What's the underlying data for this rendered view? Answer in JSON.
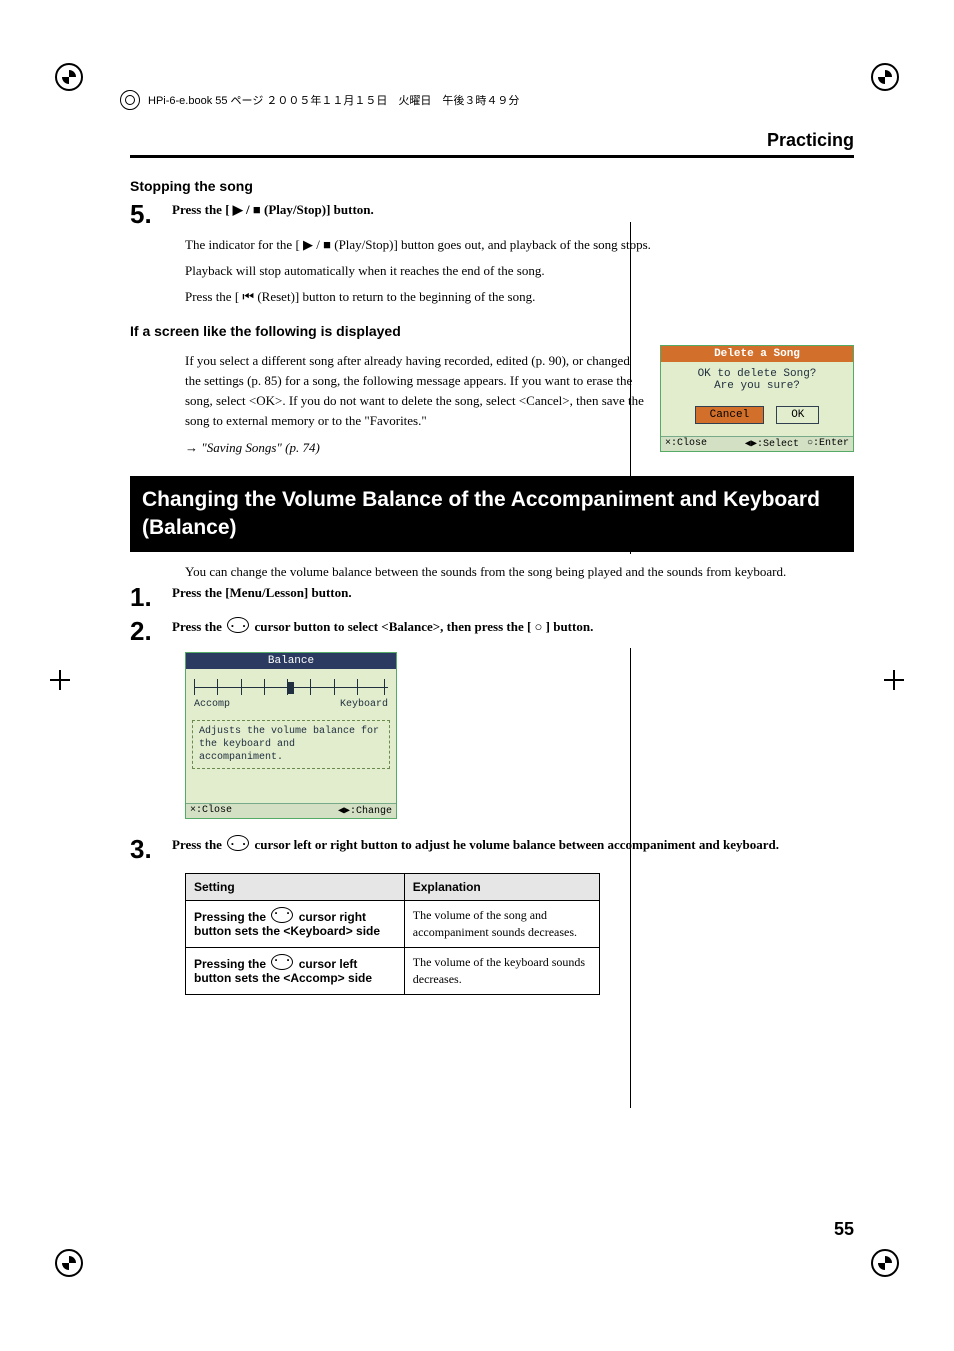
{
  "printinfo": "HPi-6-e.book 55 ページ ２００５年１１月１５日　火曜日　午後３時４９分",
  "header": {
    "section": "Practicing"
  },
  "stopping": {
    "heading": "Stopping the song",
    "step5": {
      "num": "5.",
      "head": "Press the [ ▶ / ■ (Play/Stop)] button.",
      "line1": "The indicator for the [ ▶ / ■ (Play/Stop)] button goes out, and playback of the song stops.",
      "line2": "Playback will stop automatically when it reaches the end of the song.",
      "line3": "Press the [ ⏮ (Reset)] button to return to the beginning of the song."
    }
  },
  "ifscreen": {
    "heading": "If a screen like the following is displayed",
    "para": "If you select a different song after already having recorded, edited (p. 90), or changed the settings (p. 85) for a song, the following message appears. If you want to erase the song, select <OK>. If you do not want to delete the song, select <Cancel>, then save the song to external memory or to the \"Favorites.\"",
    "ref": "→  \"Saving Songs\" (p. 74)"
  },
  "lcd_delete": {
    "title": "Delete a Song",
    "line1": "OK to delete Song?",
    "line2": "Are you sure?",
    "cancel": "Cancel",
    "ok": "OK",
    "foot_close": "×:Close",
    "foot_select": "◀▶:Select",
    "foot_enter": "○:Enter"
  },
  "banner": "Changing the Volume Balance of the Accompaniment and Keyboard (Balance)",
  "balance_intro": "You can change the volume balance between the sounds from the song being played and the sounds from keyboard.",
  "step1": {
    "num": "1.",
    "head": "Press the [Menu/Lesson] button."
  },
  "step2": {
    "num": "2.",
    "head_a": "Press the ",
    "head_b": " cursor button to select <Balance>, then press the [ ○ ] button."
  },
  "lcd_balance": {
    "title": "Balance",
    "left": "Accomp",
    "right": "Keyboard",
    "desc": "Adjusts the volume balance for the keyboard and accompaniment.",
    "foot_close": "×:Close",
    "foot_change": "◀▶:Change"
  },
  "step3": {
    "num": "3.",
    "head_a": "Press the ",
    "head_b": " cursor left or right button to adjust he volume balance between accompaniment and keyboard."
  },
  "table": {
    "header_setting": "Setting",
    "header_explanation": "Explanation",
    "row1_setting_a": "Pressing the ",
    "row1_setting_b": " cursor right button sets the <Keyboard> side",
    "row1_expl": "The volume of the song and accompaniment sounds decreases.",
    "row2_setting_a": "Pressing the ",
    "row2_setting_b": " cursor left button sets the <Accomp> side",
    "row2_expl": "The volume of the keyboard sounds decreases."
  },
  "page_number": "55"
}
